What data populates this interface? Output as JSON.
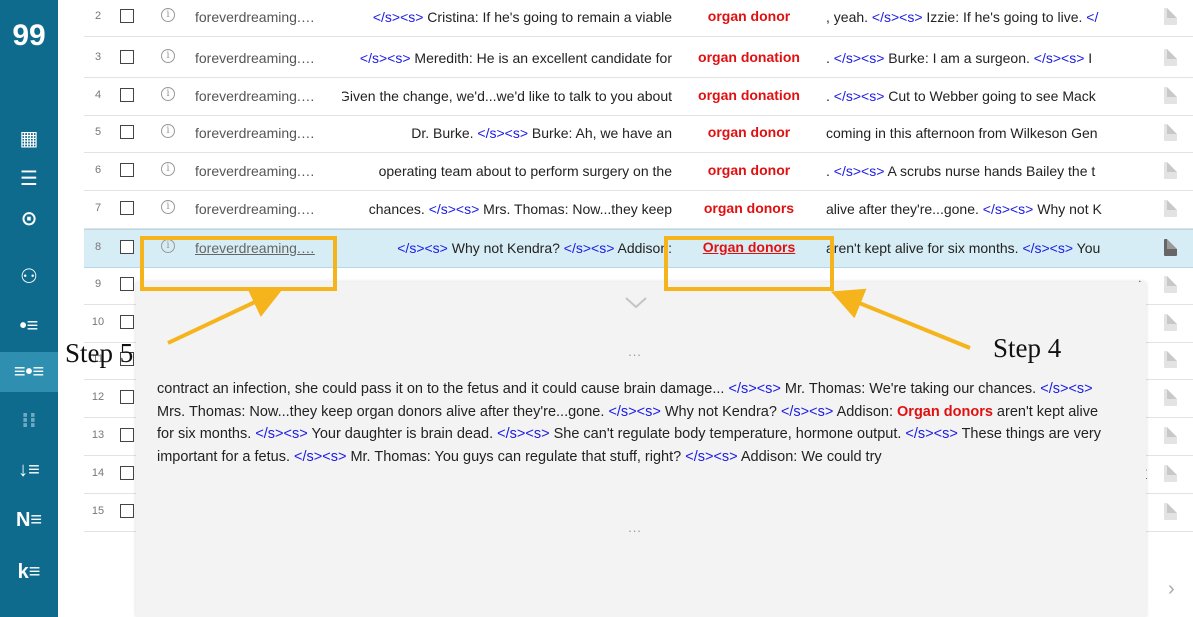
{
  "sidebar": {
    "logo": "99",
    "items": [
      {
        "name": "dashboard-icon",
        "glyph": "▦",
        "active": false
      },
      {
        "name": "list-icon",
        "glyph": "☰",
        "active": false
      },
      {
        "name": "target-icon",
        "glyph": "⊙",
        "active": false
      },
      {
        "name": "network-icon",
        "glyph": "⚇",
        "active": false
      },
      {
        "name": "bullet-list-icon",
        "glyph": "•≡",
        "active": false
      },
      {
        "name": "concordance-icon",
        "glyph": "≡•≡",
        "active": true
      },
      {
        "name": "parallel-icon",
        "glyph": "⁝⁝",
        "active": false,
        "dim": true
      },
      {
        "name": "sort-icon",
        "glyph": "↓≡",
        "active": false
      },
      {
        "name": "ne-icon",
        "glyph": "N≡",
        "active": false
      },
      {
        "name": "keyword-icon",
        "glyph": "k≡",
        "active": false
      }
    ]
  },
  "rows": [
    {
      "num": "2",
      "source": "foreverdreaming.…",
      "left": [
        {
          "t": "</s><s>",
          "tag": true
        },
        {
          "t": " Cristina: If he's going to remain a viable"
        }
      ],
      "keyword": "organ donor",
      "right": [
        {
          "t": ", yeah. "
        },
        {
          "t": "</s><s>",
          "tag": true
        },
        {
          "t": " Izzie: If he's going to live. "
        },
        {
          "t": "</",
          "tag": true
        }
      ]
    },
    {
      "num": "3",
      "source": "foreverdreaming.…",
      "left": [
        {
          "t": "</s><s>",
          "tag": true
        },
        {
          "t": " Meredith: He is an excellent candidate for"
        }
      ],
      "keyword": "organ donation",
      "right": [
        {
          "t": ". "
        },
        {
          "t": "</s><s>",
          "tag": true
        },
        {
          "t": " Burke: I am a surgeon. "
        },
        {
          "t": "</s><s>",
          "tag": true
        },
        {
          "t": " I"
        }
      ]
    },
    {
      "num": "4",
      "source": "foreverdreaming.…",
      "left": [
        {
          "t": "Given the change, we'd...we'd like to talk to you about"
        }
      ],
      "keyword": "organ donation",
      "right": [
        {
          "t": ". "
        },
        {
          "t": "</s><s>",
          "tag": true
        },
        {
          "t": " Cut to Webber going to see Mack"
        }
      ]
    },
    {
      "num": "5",
      "source": "foreverdreaming.…",
      "left": [
        {
          "t": "Dr. Burke. "
        },
        {
          "t": "</s><s>",
          "tag": true
        },
        {
          "t": " Burke: Ah, we have an"
        }
      ],
      "keyword": "organ donor",
      "right": [
        {
          "t": "coming in this afternoon from Wilkeson Gen"
        }
      ]
    },
    {
      "num": "6",
      "source": "foreverdreaming.…",
      "left": [
        {
          "t": "operating team about to perform surgery on the"
        }
      ],
      "keyword": "organ donor",
      "right": [
        {
          "t": ". "
        },
        {
          "t": "</s><s>",
          "tag": true
        },
        {
          "t": " A scrubs nurse hands Bailey the t"
        }
      ]
    },
    {
      "num": "7",
      "source": "foreverdreaming.…",
      "left": [
        {
          "t": "chances. "
        },
        {
          "t": "</s><s>",
          "tag": true
        },
        {
          "t": " Mrs. Thomas: Now...they keep"
        }
      ],
      "keyword": "organ donors",
      "right": [
        {
          "t": "alive after they're...gone. "
        },
        {
          "t": "</s><s>",
          "tag": true
        },
        {
          "t": " Why not K"
        }
      ]
    },
    {
      "num": "8",
      "source": "foreverdreaming.…",
      "left": [
        {
          "t": "</s><s>",
          "tag": true
        },
        {
          "t": " Why not Kendra? "
        },
        {
          "t": "</s><s>",
          "tag": true
        },
        {
          "t": " Addison:"
        }
      ],
      "keyword": "Organ donors",
      "right": [
        {
          "t": "aren't kept alive for six months. "
        },
        {
          "t": "</s><s>",
          "tag": true
        },
        {
          "t": " You"
        }
      ],
      "selected": true
    },
    {
      "num": "9",
      "right_edge": "t"
    },
    {
      "num": "10",
      "right_edge": ""
    },
    {
      "num": "11",
      "right_edge": ""
    },
    {
      "num": "12",
      "right_edge": ""
    },
    {
      "num": "13",
      "right_edge": ":"
    },
    {
      "num": "14",
      "right_edge": "E"
    },
    {
      "num": "15",
      "right_edge": ":"
    }
  ],
  "panel": {
    "dots_top": "...",
    "dots_bottom": "...",
    "segments": [
      {
        "t": "contract an infection, she could pass it on to the fetus and it could cause brain damage... "
      },
      {
        "t": "</s><s>",
        "tag": true
      },
      {
        "t": " Mr. Thomas: We're taking our chances. "
      },
      {
        "t": "</s><s>",
        "tag": true
      },
      {
        "t": " Mrs. Thomas: Now...they keep organ donors alive after they're...gone. "
      },
      {
        "t": "</s><s>",
        "tag": true
      },
      {
        "t": " Why not Kendra? "
      },
      {
        "t": "</s><s>",
        "tag": true
      },
      {
        "t": " Addison: "
      },
      {
        "t": "Organ donors",
        "kw": true
      },
      {
        "t": " aren't kept alive for six months. "
      },
      {
        "t": "</s><s>",
        "tag": true
      },
      {
        "t": " Your daughter is brain dead. "
      },
      {
        "t": "</s><s>",
        "tag": true
      },
      {
        "t": " She can't regulate body temperature, hormone output. "
      },
      {
        "t": "</s><s>",
        "tag": true
      },
      {
        "t": " These things are very important for a fetus. "
      },
      {
        "t": "</s><s>",
        "tag": true
      },
      {
        "t": " Mr. Thomas: You guys can regulate that stuff, right? "
      },
      {
        "t": "</s><s>",
        "tag": true
      },
      {
        "t": " Addison: We could try"
      }
    ]
  },
  "annotations": {
    "step5": "Step 5",
    "step4": "Step 4",
    "color": "#f5b41c"
  },
  "colors": {
    "sidebar": "#0f6b8e",
    "sidebar_active": "#2f8fb0",
    "keyword": "#e01010",
    "tag": "#1a1ae6",
    "selected_row": "#d7edf5"
  }
}
